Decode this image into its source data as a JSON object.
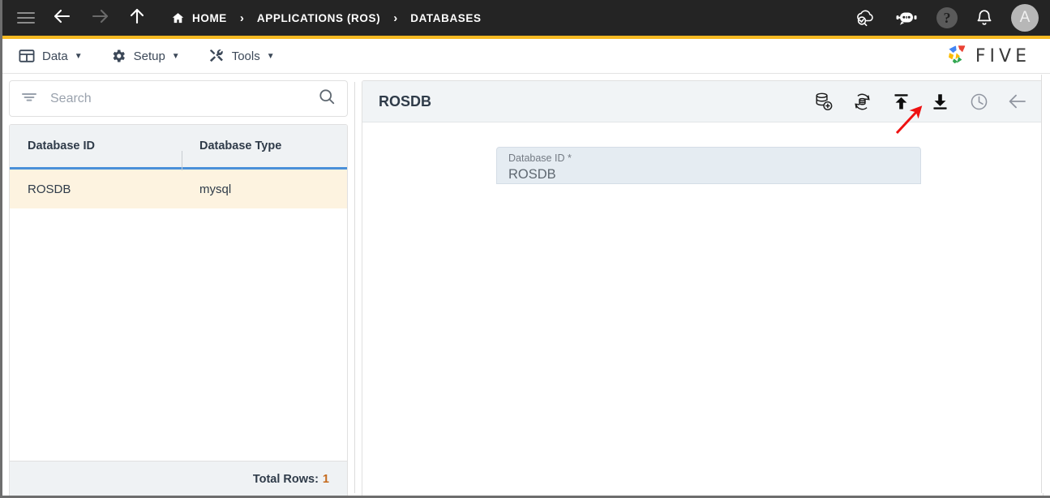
{
  "topbar": {
    "menu_icon": "hamburger-icon",
    "back_icon": "arrow-left-icon",
    "forward_icon": "arrow-right-icon",
    "up_icon": "arrow-up-icon",
    "breadcrumbs": [
      {
        "label": "HOME",
        "icon": "home-icon"
      },
      {
        "label": "APPLICATIONS (ROS)",
        "icon": ""
      },
      {
        "label": "DATABASES",
        "icon": ""
      }
    ],
    "separator": "›",
    "actions": [
      {
        "name": "cloud-check-icon",
        "label": ""
      },
      {
        "name": "chatbot-icon",
        "label": ""
      },
      {
        "name": "help-icon",
        "label": "?"
      },
      {
        "name": "bell-icon",
        "label": ""
      }
    ],
    "avatar_initial": "A",
    "accent_color": "#f6b922"
  },
  "menubar": {
    "items": [
      {
        "label": "Data",
        "icon": "table-icon",
        "caret": "▼"
      },
      {
        "label": "Setup",
        "icon": "gear-icon",
        "caret": "▼"
      },
      {
        "label": "Tools",
        "icon": "tools-icon",
        "caret": "▼"
      }
    ],
    "brand": {
      "text": "FIVE",
      "logo_icon": "five-pinwheel-logo",
      "logo_colors": [
        "#4285f4",
        "#ea4335",
        "#fbbc05",
        "#34a853"
      ]
    }
  },
  "left_panel": {
    "search": {
      "placeholder": "Search",
      "value": "",
      "filter_icon": "filter-icon",
      "search_icon": "search-icon"
    },
    "grid": {
      "columns": [
        "Database ID",
        "Database Type"
      ],
      "rows": [
        {
          "database_id": "ROSDB",
          "database_type": "mysql",
          "selected": true
        }
      ],
      "footer_label": "Total Rows:",
      "footer_value": "1",
      "selected_row_color": "#fdf3e0",
      "header_underline_color": "#4a90d9"
    }
  },
  "right_panel": {
    "title": "ROSDB",
    "toolbar": [
      {
        "name": "add-database-icon",
        "tooltip": "Add Database"
      },
      {
        "name": "sync-database-icon",
        "tooltip": "Sync Database"
      },
      {
        "name": "upload-icon",
        "tooltip": "Upload",
        "highlighted": true
      },
      {
        "name": "download-icon",
        "tooltip": "Download"
      },
      {
        "name": "history-icon",
        "tooltip": "History"
      },
      {
        "name": "back-icon",
        "tooltip": "Back"
      }
    ],
    "form": {
      "fields": [
        {
          "label": "Database ID *",
          "value": "ROSDB",
          "readonly": true
        }
      ]
    }
  },
  "annotation": {
    "arrow_color": "#ee1111",
    "target": "upload-icon"
  }
}
